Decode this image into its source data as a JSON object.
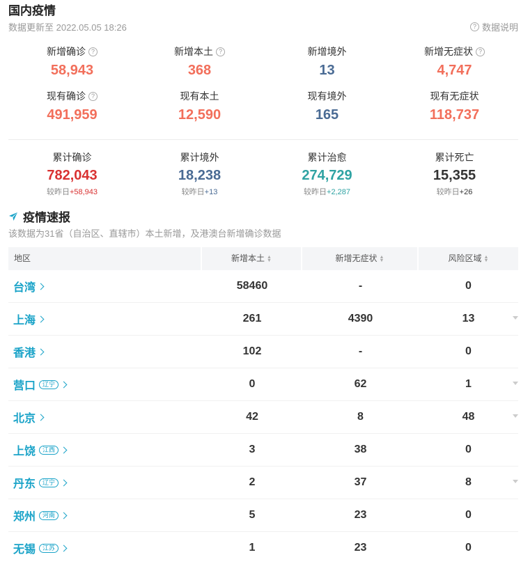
{
  "header": {
    "title": "国内疫情",
    "update_time": "数据更新至 2022.05.05 18:26",
    "help_label": "数据说明"
  },
  "colors": {
    "confirm": "#f26f5b",
    "local": "#f26f5b",
    "imported": "#4a6b94",
    "asymptomatic": "#f26f5b",
    "total_confirm": "#d93232",
    "cured": "#2fa3a3",
    "death": "#333333",
    "accent": "#1aa3c8"
  },
  "stats_row1": [
    {
      "label": "新增确诊",
      "value": "58,943",
      "help": true,
      "color": "#f26f5b"
    },
    {
      "label": "新增本土",
      "value": "368",
      "help": true,
      "color": "#f26f5b"
    },
    {
      "label": "新增境外",
      "value": "13",
      "help": false,
      "color": "#4a6b94"
    },
    {
      "label": "新增无症状",
      "value": "4,747",
      "help": true,
      "color": "#f26f5b"
    }
  ],
  "stats_row2": [
    {
      "label": "现有确诊",
      "value": "491,959",
      "help": true,
      "color": "#f26f5b"
    },
    {
      "label": "现有本土",
      "value": "12,590",
      "help": false,
      "color": "#f26f5b"
    },
    {
      "label": "现有境外",
      "value": "165",
      "help": false,
      "color": "#4a6b94"
    },
    {
      "label": "现有无症状",
      "value": "118,737",
      "help": false,
      "color": "#f26f5b"
    }
  ],
  "totals": [
    {
      "label": "累计确诊",
      "value": "782,043",
      "delta_label": "较昨日",
      "delta": "+58,943",
      "color": "#d93232",
      "delta_color": "#d93232"
    },
    {
      "label": "累计境外",
      "value": "18,238",
      "delta_label": "较昨日",
      "delta": "+13",
      "color": "#4a6b94",
      "delta_color": "#4a6b94"
    },
    {
      "label": "累计治愈",
      "value": "274,729",
      "delta_label": "较昨日",
      "delta": "+2,287",
      "color": "#2fa3a3",
      "delta_color": "#2fa3a3"
    },
    {
      "label": "累计死亡",
      "value": "15,355",
      "delta_label": "较昨日",
      "delta": "+26",
      "color": "#333333",
      "delta_color": "#333333"
    }
  ],
  "section": {
    "title": "疫情速报",
    "desc": "该数据为31省（自治区、直辖市）本土新增，及港澳台新增确诊数据"
  },
  "table": {
    "headers": [
      "地区",
      "新增本土",
      "新增无症状",
      "风险区域"
    ],
    "rows": [
      {
        "area": "台湾",
        "province": "",
        "local": "58460",
        "asym": "-",
        "risk": "0",
        "expandable": false
      },
      {
        "area": "上海",
        "province": "",
        "local": "261",
        "asym": "4390",
        "risk": "13",
        "expandable": true
      },
      {
        "area": "香港",
        "province": "",
        "local": "102",
        "asym": "-",
        "risk": "0",
        "expandable": false
      },
      {
        "area": "营口",
        "province": "辽宁",
        "local": "0",
        "asym": "62",
        "risk": "1",
        "expandable": true
      },
      {
        "area": "北京",
        "province": "",
        "local": "42",
        "asym": "8",
        "risk": "48",
        "expandable": true
      },
      {
        "area": "上饶",
        "province": "江西",
        "local": "3",
        "asym": "38",
        "risk": "0",
        "expandable": false
      },
      {
        "area": "丹东",
        "province": "辽宁",
        "local": "2",
        "asym": "37",
        "risk": "8",
        "expandable": true
      },
      {
        "area": "郑州",
        "province": "河南",
        "local": "5",
        "asym": "23",
        "risk": "0",
        "expandable": false
      },
      {
        "area": "无锡",
        "province": "江苏",
        "local": "1",
        "asym": "23",
        "risk": "0",
        "expandable": false
      }
    ]
  }
}
